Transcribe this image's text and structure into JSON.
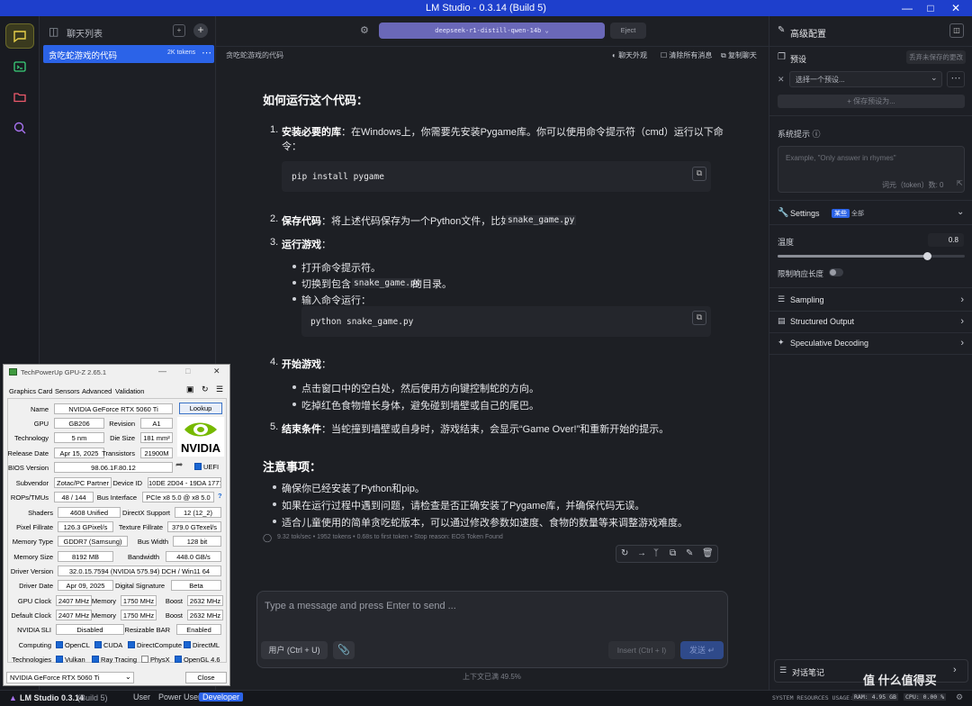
{
  "window": {
    "title": "LM Studio - 0.3.14 (Build 5)"
  },
  "chatlist": {
    "header": "聊天列表",
    "active_chat": {
      "title": "贪吃蛇游戏的代码",
      "tokens": "2K tokens"
    }
  },
  "topbar": {
    "model": "deepseek-r1-distill-qwen-14b",
    "eject": "Eject",
    "chat_title": "贪吃蛇游戏的代码",
    "appearance": "聊天外观",
    "clear": "清除所有消息",
    "duplicate": "复制聊天"
  },
  "message": {
    "heading1": "如何运行这个代码：",
    "s1_num": "1.",
    "s1_bold": "安装必要的库",
    "s1_text": "：在Windows上，你需要先安装Pygame库。你可以使用命令提示符（cmd）运行以下命",
    "s1_text2": "令：",
    "code1": "pip install pygame",
    "s2_num": "2.",
    "s2_bold": "保存代码",
    "s2_text": "：将上述代码保存为一个Python文件，比如",
    "s2_code": "snake_game.py",
    "s2_end": "。",
    "s3_num": "3.",
    "s3_bold": "运行游戏",
    "s3_text": "：",
    "s3_b1": "打开命令提示符。",
    "s3_b2a": "切换到包含",
    "s3_b2code": "snake_game.py",
    "s3_b2b": "的目录。",
    "s3_b3": "输入命令运行：",
    "code2": "python snake_game.py",
    "s4_num": "4.",
    "s4_bold": "开始游戏",
    "s4_text": "：",
    "s4_b1": "点击窗口中的空白处，然后使用方向键控制蛇的方向。",
    "s4_b2": "吃掉红色食物增长身体，避免碰到墙壁或自己的尾巴。",
    "s5_num": "5.",
    "s5_bold": "结束条件",
    "s5_text": "：当蛇撞到墙壁或自身时，游戏结束，会显示“Game Over!”和重新开始的提示。",
    "heading2": "注意事项：",
    "n1": "确保你已经安装了Python和pip。",
    "n2": "如果在运行过程中遇到问题，请检查是否正确安装了Pygame库，并确保代码无误。",
    "n3": "适合儿童使用的简单贪吃蛇版本，可以通过修改参数如速度、食物的数量等来调整游戏难度。",
    "stats": "9.32 tok/sec • 1952 tokens • 0.68s to first token • Stop reason: EOS Token Found"
  },
  "input": {
    "placeholder": "Type a message and press Enter to send ...",
    "user_btn": "用户 (Ctrl + U)",
    "insert_btn": "Insert (Ctrl + I)",
    "send_btn": "发送",
    "context": "上下文已满 49.5%"
  },
  "right": {
    "title": "高级配置",
    "preset_label": "预设",
    "unsaved": "丢弃未保存的更改",
    "preset_select": "选择一个预设...",
    "save_preset": "+ 保存预设为...",
    "system_prompt": "系统提示",
    "sp_placeholder": "Example, \"Only answer in rhymes\"",
    "sp_tokens": "词元（token）数: 0",
    "settings": "Settings",
    "settings_badge": "某些",
    "settings_all": "全部",
    "temperature": "温度",
    "temperature_val": "0.8",
    "temperature_level": 0.8,
    "limit": "限制响应长度",
    "sampling": "Sampling",
    "structured": "Structured Output",
    "speculative": "Speculative Decoding",
    "notes": "对话笔记"
  },
  "statusbar": {
    "app": "LM Studio 0.3.14",
    "build": "(Build 5)",
    "user": "User",
    "power": "Power User",
    "dev": "Developer",
    "resources": "SYSTEM RESOURCES USAGE:",
    "ram": "RAM: 4.95 GB",
    "cpu": "CPU: 0.00 %"
  },
  "watermark": "值 什么值得买",
  "gpuz": {
    "title": "TechPowerUp GPU-Z 2.65.1",
    "tabs": [
      "Graphics Card",
      "Sensors",
      "Advanced",
      "Validation"
    ],
    "lookup": "Lookup",
    "name": "NVIDIA GeForce RTX 5060 Ti",
    "gpu": "GB206",
    "revision": "A1",
    "technology": "5 nm",
    "die_size": "181 mm²",
    "release_date": "Apr 15, 2025",
    "transistors": "21900M",
    "bios": "98.06.1F.80.12",
    "uefi": "UEFI",
    "subvendor": "Zotac/PC Partner",
    "device_id": "10DE 2D04 - 19DA 1777",
    "rops": "48 / 144",
    "bus_interface": "PCIe x8 5.0 @ x8 5.0",
    "shaders": "4608 Unified",
    "directx": "12 (12_2)",
    "pixel_fill": "126.3 GPixel/s",
    "texture_fill": "379.0 GTexel/s",
    "mem_type": "GDDR7 (Samsung)",
    "bus_width": "128 bit",
    "mem_size": "8192 MB",
    "bandwidth": "448.0 GB/s",
    "driver_version": "32.0.15.7594 (NVIDIA 575.94) DCH / Win11 64",
    "driver_date": "Apr 09, 2025",
    "digital_sig": "Beta",
    "gpu_clock": "2407 MHz",
    "memory_clock": "1750 MHz",
    "boost": "2632 MHz",
    "def_clock": "2407 MHz",
    "def_memory": "1750 MHz",
    "def_boost": "2632 MHz",
    "sli": "Disabled",
    "rebar": "Enabled",
    "labels": {
      "name": "Name",
      "gpu": "GPU",
      "revision": "Revision",
      "technology": "Technology",
      "die_size": "Die Size",
      "release": "Release Date",
      "transistors": "Transistors",
      "bios": "BIOS Version",
      "subvendor": "Subvendor",
      "device_id": "Device ID",
      "rops": "ROPs/TMUs",
      "bus_interface": "Bus Interface",
      "shaders": "Shaders",
      "directx": "DirectX Support",
      "pixel": "Pixel Fillrate",
      "texture": "Texture Fillrate",
      "mem_type": "Memory Type",
      "bus_width": "Bus Width",
      "mem_size": "Memory Size",
      "bandwidth": "Bandwidth",
      "driver_ver": "Driver Version",
      "driver_date": "Driver Date",
      "digsig": "Digital Signature",
      "gpu_clock": "GPU Clock",
      "memory": "Memory",
      "boost": "Boost",
      "default_clock": "Default Clock",
      "sli": "NVIDIA SLI",
      "rebar": "Resizable BAR",
      "computing": "Computing",
      "technologies": "Technologies"
    },
    "computing": [
      "OpenCL",
      "CUDA",
      "DirectCompute",
      "DirectML"
    ],
    "technologies": [
      "Vulkan",
      "Ray Tracing",
      "PhysX",
      "OpenGL 4.6"
    ],
    "select": "NVIDIA GeForce RTX 5060 Ti",
    "close": "Close",
    "logo": "NVIDIA"
  }
}
